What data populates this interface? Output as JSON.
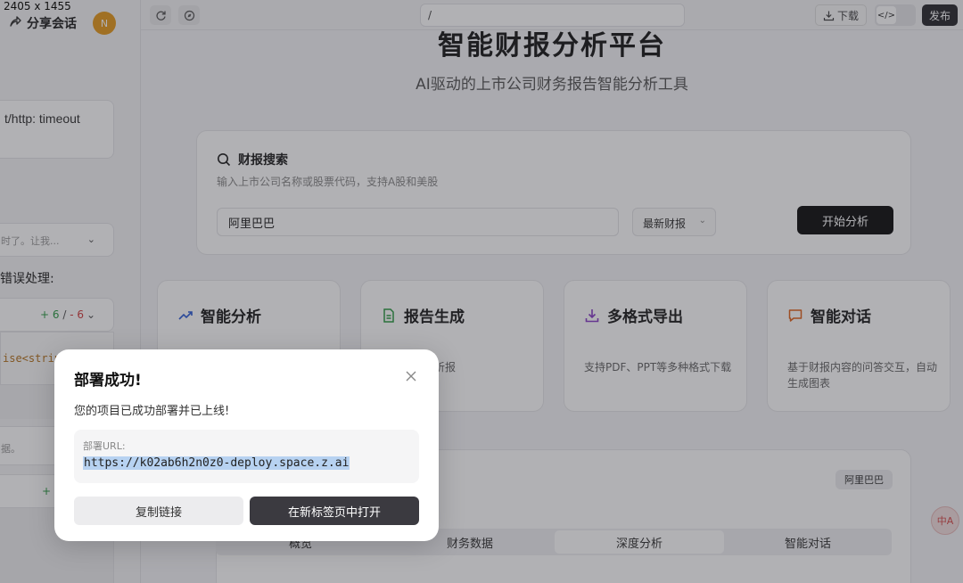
{
  "screen_size_label": "2405 x 1455",
  "left_panel": {
    "share_label": "分享会话",
    "avatar_initial": "N",
    "error_text": "t/http: timeout",
    "collapsed_text": "时了。让我...",
    "error_handling_label": "错误处理:",
    "diff1": {
      "plus": "+ 6",
      "sep": "/",
      "minus": "- 6"
    },
    "code_snippet": "ise<strin",
    "note_text": "据。",
    "diff2": {
      "plus": "+ 4"
    }
  },
  "toolbar": {
    "url": "/",
    "download_label": "下载",
    "code_icon": "</>",
    "publish_label": "发布"
  },
  "main": {
    "title": "智能财报分析平台",
    "subtitle": "AI驱动的上市公司财务报告智能分析工具",
    "search": {
      "title": "财报搜索",
      "description": "输入上市公司名称或股票代码，支持A股和美股",
      "input_value": "阿里巴巴",
      "select_value": "最新财报",
      "button_label": "开始分析"
    },
    "features": [
      {
        "title": "智能分析",
        "desc": "",
        "icon": "trending-up-icon",
        "color": "#2f5fd6"
      },
      {
        "title": "报告生成",
        "desc": "文并茂的分析报",
        "icon": "document-icon",
        "color": "#2e9b46"
      },
      {
        "title": "多格式导出",
        "desc": "支持PDF、PPT等多种格式下载",
        "icon": "download-icon",
        "color": "#8a3fc7"
      },
      {
        "title": "智能对话",
        "desc": "基于财报内容的问答交互，自动生成图表",
        "icon": "chat-icon",
        "color": "#e0631d"
      }
    ],
    "company_badge": "阿里巴巴",
    "tabs": [
      "概览",
      "财务数据",
      "深度分析",
      "智能对话"
    ],
    "active_tab": "深度分析",
    "fab_label": "中A"
  },
  "modal": {
    "title": "部署成功!",
    "description": "您的项目已成功部署并已上线!",
    "url_label": "部署URL:",
    "url": "https://k02ab6h2n0z0-deploy.space.z.ai",
    "copy_label": "复制链接",
    "open_label": "在新标签页中打开"
  }
}
